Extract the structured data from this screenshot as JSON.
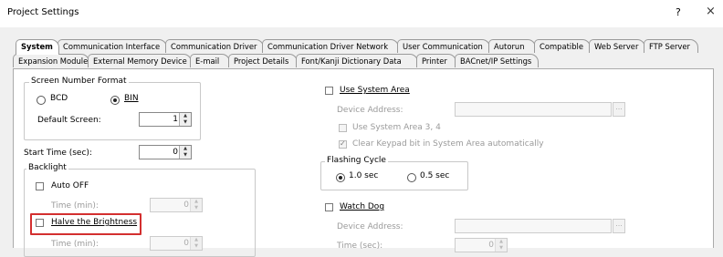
{
  "window": {
    "title": "Project Settings",
    "help_icon": "?",
    "close_icon": "×"
  },
  "tabs_row1": [
    {
      "label": "System",
      "active": true
    },
    {
      "label": "Communication Interface"
    },
    {
      "label": "Communication Driver"
    },
    {
      "label": "Communication Driver Network"
    },
    {
      "label": "User Communication"
    },
    {
      "label": "Autorun"
    },
    {
      "label": "Compatible"
    },
    {
      "label": "Web Server"
    },
    {
      "label": "FTP Server"
    }
  ],
  "tabs_row2": [
    {
      "label": "Expansion Module"
    },
    {
      "label": "External Memory Device"
    },
    {
      "label": "E-mail"
    },
    {
      "label": "Project Details"
    },
    {
      "label": "Font/Kanji Dictionary Data"
    },
    {
      "label": "Printer"
    },
    {
      "label": "BACnet/IP Settings"
    }
  ],
  "screen_number_format": {
    "legend": "Screen Number Format",
    "bcd_label": "BCD",
    "bin_label": "BIN",
    "selected": "BIN",
    "default_screen_label": "Default Screen:",
    "default_screen_value": "1"
  },
  "start_time": {
    "label": "Start Time (sec):",
    "value": "0"
  },
  "backlight": {
    "legend": "Backlight",
    "auto_off_label": "Auto OFF",
    "auto_off_checked": false,
    "time1_label": "Time (min):",
    "time1_value": "0",
    "halve_label": "Halve the Brightness",
    "halve_checked": false,
    "time2_label": "Time (min):",
    "time2_value": "0"
  },
  "system_area": {
    "use_label": "Use System Area",
    "use_checked": false,
    "device_address_label": "Device Address:",
    "device_address_value": "",
    "browse_label": "...",
    "use_area_34_label": "Use System Area 3, 4",
    "clear_keypad_label": "Clear Keypad bit in System Area automatically",
    "clear_keypad_checked": true
  },
  "flashing_cycle": {
    "legend": "Flashing Cycle",
    "opt1_label": "1.0 sec",
    "opt2_label": "0.5 sec",
    "selected": "1.0 sec"
  },
  "watch_dog": {
    "label": "Watch Dog",
    "checked": false,
    "device_address_label": "Device Address:",
    "device_address_value": "",
    "browse_label": "...",
    "time_label": "Time (sec):",
    "time_value": "0"
  },
  "colors": {
    "highlight": "#d32f2f",
    "panel": "#ffffff",
    "chrome": "#f0f0f0"
  }
}
